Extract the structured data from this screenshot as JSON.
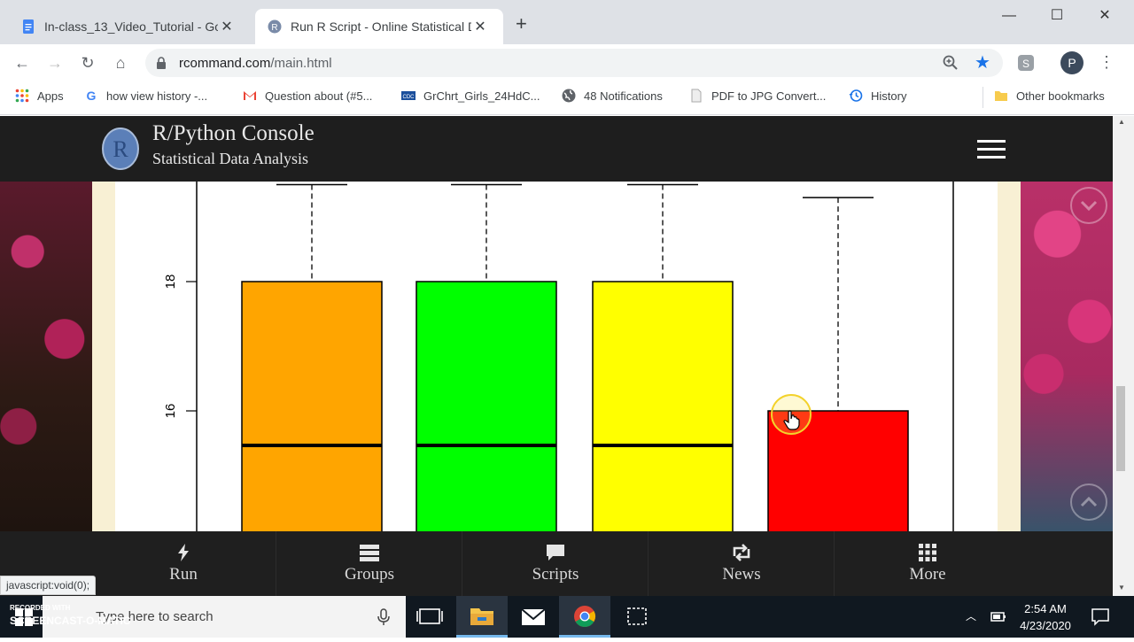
{
  "browser": {
    "tabs": [
      {
        "title": "In-class_13_Video_Tutorial - Goo",
        "favicon": "docs-icon",
        "active": false
      },
      {
        "title": "Run R Script - Online Statistical D",
        "favicon": "r-logo-icon",
        "active": true
      }
    ],
    "new_tab": "+",
    "url_domain": "rcommand.com",
    "url_path": "/main.html",
    "profile_initial": "P",
    "bookmarks": [
      {
        "label": "Apps",
        "icon": "apps-grid-icon"
      },
      {
        "label": "how view history -...",
        "icon": "google-icon"
      },
      {
        "label": "Question about (#5...",
        "icon": "gmail-icon"
      },
      {
        "label": "GrChrt_Girls_24HdC...",
        "icon": "cdc-icon"
      },
      {
        "label": "48 Notifications",
        "icon": "globe-icon"
      },
      {
        "label": "PDF to JPG Convert...",
        "icon": "page-icon"
      },
      {
        "label": "History",
        "icon": "history-icon"
      },
      {
        "label": "Other bookmarks",
        "icon": "folder-icon"
      }
    ]
  },
  "site": {
    "title": "R/Python Console",
    "subtitle": "Statistical Data Analysis",
    "logo_letter": "R",
    "nav": [
      {
        "label": "Run",
        "icon": "bolt-icon"
      },
      {
        "label": "Groups",
        "icon": "list-icon"
      },
      {
        "label": "Scripts",
        "icon": "comment-icon"
      },
      {
        "label": "News",
        "icon": "retweet-icon"
      },
      {
        "label": "More",
        "icon": "grid-icon"
      }
    ],
    "status_url": "javascript:void(0);"
  },
  "chart_data": {
    "type": "boxplot",
    "title": "",
    "xlabel": "",
    "ylabel": "",
    "y_ticks": [
      16,
      18
    ],
    "visible_y_range": [
      14.2,
      19.5
    ],
    "boxes": [
      {
        "color": "#ffa500",
        "q3": 18,
        "median": 15,
        "whisker_high": 19.5
      },
      {
        "color": "#00ff00",
        "q3": 18,
        "median": 15,
        "whisker_high": 19.5
      },
      {
        "color": "#ffff00",
        "q3": 18,
        "median": 15,
        "whisker_high": 19.5
      },
      {
        "color": "#ff0000",
        "q3": 16,
        "median": null,
        "whisker_high": 19.3
      }
    ]
  },
  "taskbar": {
    "search_placeholder": "Type here to search",
    "time": "2:54 AM",
    "date": "4/23/2020",
    "recorder_line1": "RECORDED WITH",
    "recorder_line2": "SCREENCAST-O-MATIC"
  }
}
